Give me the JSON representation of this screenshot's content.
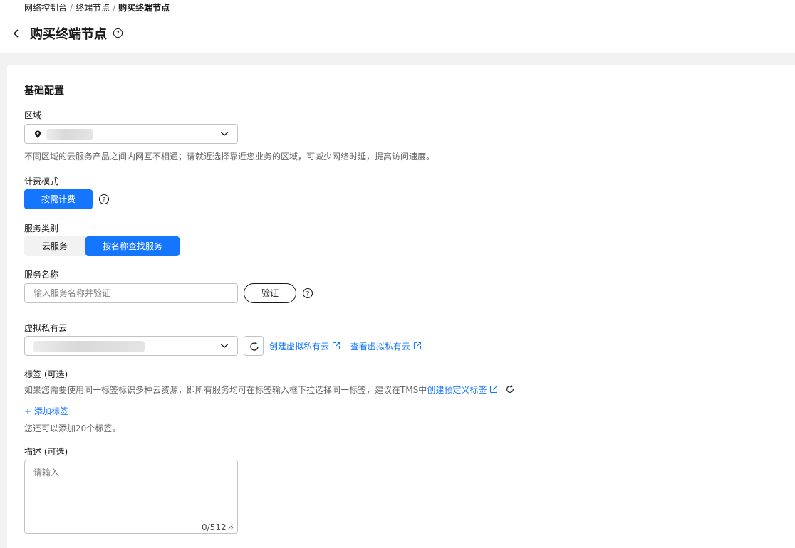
{
  "breadcrumb": {
    "items": [
      "网络控制台",
      "终端节点"
    ],
    "separator": "/",
    "current": "购买终端节点"
  },
  "header": {
    "title": "购买终端节点"
  },
  "basic": {
    "section_title": "基础配置",
    "region": {
      "label": "区域",
      "hint": "不同区域的云服务产品之间内网互不相通；请就近选择靠近您业务的区域，可减少网络时延，提高访问速度。"
    },
    "billing": {
      "label": "计费模式",
      "option": "按需计费"
    },
    "service_type": {
      "label": "服务类别",
      "options": [
        "云服务",
        "按名称查找服务"
      ],
      "selected": "按名称查找服务"
    },
    "service_name": {
      "label": "服务名称",
      "placeholder": "输入服务名称并验证",
      "verify_label": "验证"
    },
    "vpc": {
      "label": "虚拟私有云",
      "create_link": "创建虚拟私有云",
      "view_link": "查看虚拟私有云"
    },
    "tags": {
      "label": "标签 (可选)",
      "hint": "如果您需要使用同一标签标识多种云资源，即所有服务均可在标签输入框下拉选择同一标签，建议在TMS中",
      "create_link": "创建预定义标签",
      "add_label": "+ 添加标签",
      "remaining": "您还可以添加20个标签。"
    },
    "description": {
      "label": "描述 (可选)",
      "placeholder": "请输入",
      "counter": "0/512"
    }
  },
  "colors": {
    "primary": "#1476ff",
    "text": "#191919",
    "hint": "#666666"
  },
  "icons": [
    "chevron-left-icon",
    "help-icon",
    "location-pin-icon",
    "chevron-down-icon",
    "refresh-icon",
    "external-link-icon",
    "resize-icon"
  ]
}
